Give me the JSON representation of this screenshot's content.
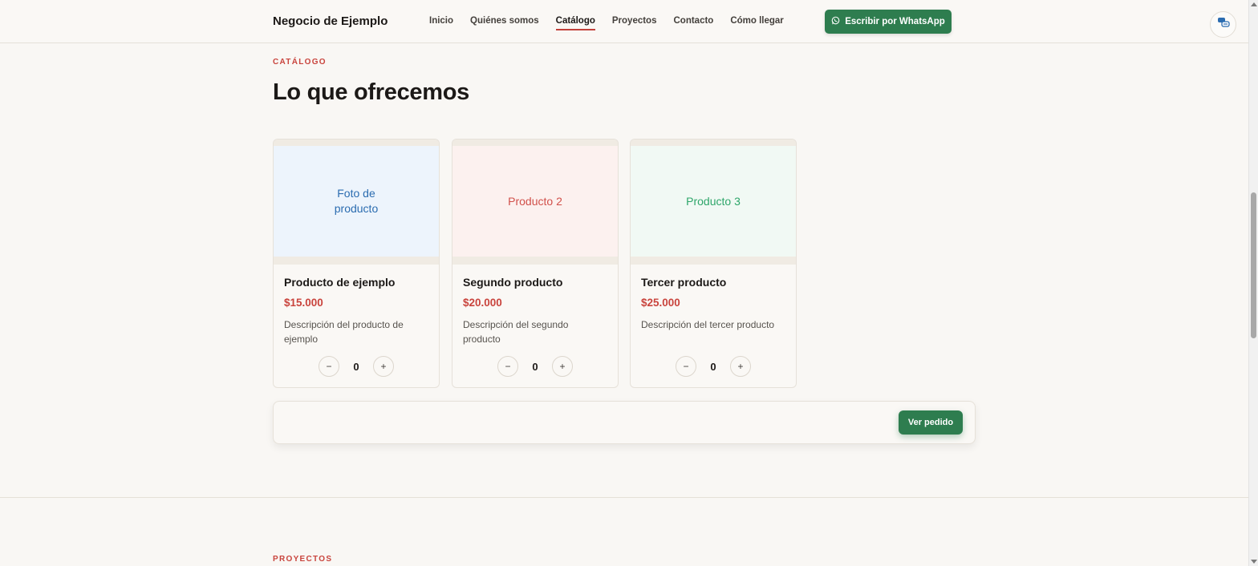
{
  "header": {
    "brand": "Negocio de Ejemplo",
    "nav": [
      "Inicio",
      "Quiénes somos",
      "Catálogo",
      "Proyectos",
      "Contacto",
      "Cómo llegar"
    ],
    "active_nav": "Catálogo",
    "whatsapp_label": "Escribir por WhatsApp",
    "whatsapp_icon": "whatsapp-icon",
    "lang_icon": "chat-translate-icon"
  },
  "catalog": {
    "eyebrow": "CATÁLOGO",
    "title": "Lo que ofrecemos",
    "products": [
      {
        "image_text": "Foto de producto",
        "name": "Producto de ejemplo",
        "price": "$15.000",
        "description": "Descripción del producto de ejemplo",
        "quantity": "0",
        "image_bg": "#edf4fc",
        "image_color": "#2b6cb0"
      },
      {
        "image_text": "Producto 2",
        "name": "Segundo producto",
        "price": "$20.000",
        "description": "Descripción del segundo producto",
        "quantity": "0",
        "image_bg": "#fcf1ef",
        "image_color": "#d1504a"
      },
      {
        "image_text": "Producto 3",
        "name": "Tercer producto",
        "price": "$25.000",
        "description": "Descripción del tercer producto",
        "quantity": "0",
        "image_bg": "#f1f9f4",
        "image_color": "#2ea66a"
      }
    ],
    "minus_label": "−",
    "plus_label": "+",
    "order_button": "Ver pedido"
  },
  "projects": {
    "eyebrow": "PROYECTOS"
  },
  "colors": {
    "accent": "#c9443d",
    "whatsapp_green": "#2e7d4f",
    "page_bg": "#f9f7f4"
  }
}
